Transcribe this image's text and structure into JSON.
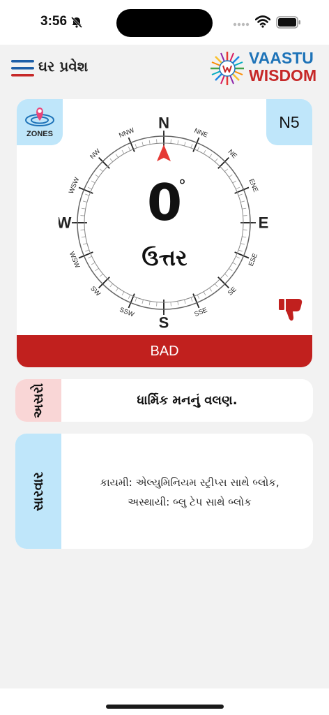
{
  "status_bar": {
    "time": "3:56"
  },
  "header": {
    "title": "ઘર પ્રવેશ",
    "logo_line1": "VAASTU",
    "logo_line2": "WISDOM"
  },
  "compass": {
    "zones_label": "ZONES",
    "zone_badge": "N5",
    "degree": "0",
    "degree_symbol": "°",
    "direction_name": "ઉત્તર",
    "verdict": "BAD",
    "cardinals": [
      "N",
      "E",
      "S",
      "W"
    ],
    "intercardinals": [
      "NNE",
      "NE",
      "ENE",
      "ESE",
      "SE",
      "SSE",
      "SSW",
      "SW",
      "WSW",
      "WSW",
      "NW",
      "NNW"
    ]
  },
  "effect": {
    "label": "અસરો",
    "text": "ધાર્મિક મનનું વલણ."
  },
  "remedy": {
    "label": "સારવાર",
    "line1": "કાયમી: એલ્યુમિનિયમ સ્ટ્રીપ્સ સાથે બ્લોક,",
    "line2": "અસ્થાયી: બ્લુ ટેપ સાથે બ્લોક"
  },
  "colors": {
    "accent_blue": "#bfe6fa",
    "bad_red": "#c1201e",
    "effect_pink": "#f9d6d6",
    "logo_blue": "#1e73b8",
    "logo_red": "#c62828"
  }
}
